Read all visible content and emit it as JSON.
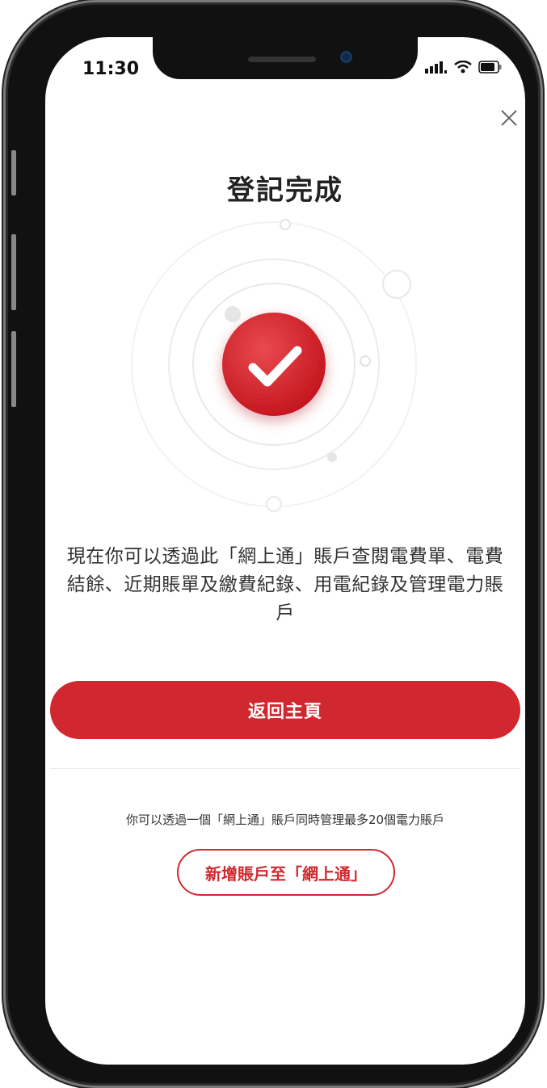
{
  "status_bar": {
    "time": "11:30",
    "icons": [
      "signal-icon",
      "wifi-icon",
      "battery-icon"
    ]
  },
  "page": {
    "title": "登記完成",
    "description_lines": [
      "現在你可以透過此「網上通」賬戶查閱電費單、電費",
      "結餘、近期賬單及繳費紀錄、用電紀錄及管理電力賬",
      "戶"
    ],
    "primary_button_label": "返回主頁",
    "info_text": "你可以透過一個「網上通」賬戶同時管理最多20個電力賬戶",
    "secondary_button_label": "新增賬戶至「網上通」",
    "close_icon": "close-icon",
    "success_icon": "check-icon"
  },
  "colors": {
    "accent": "#d1282f",
    "text": "#333333"
  }
}
